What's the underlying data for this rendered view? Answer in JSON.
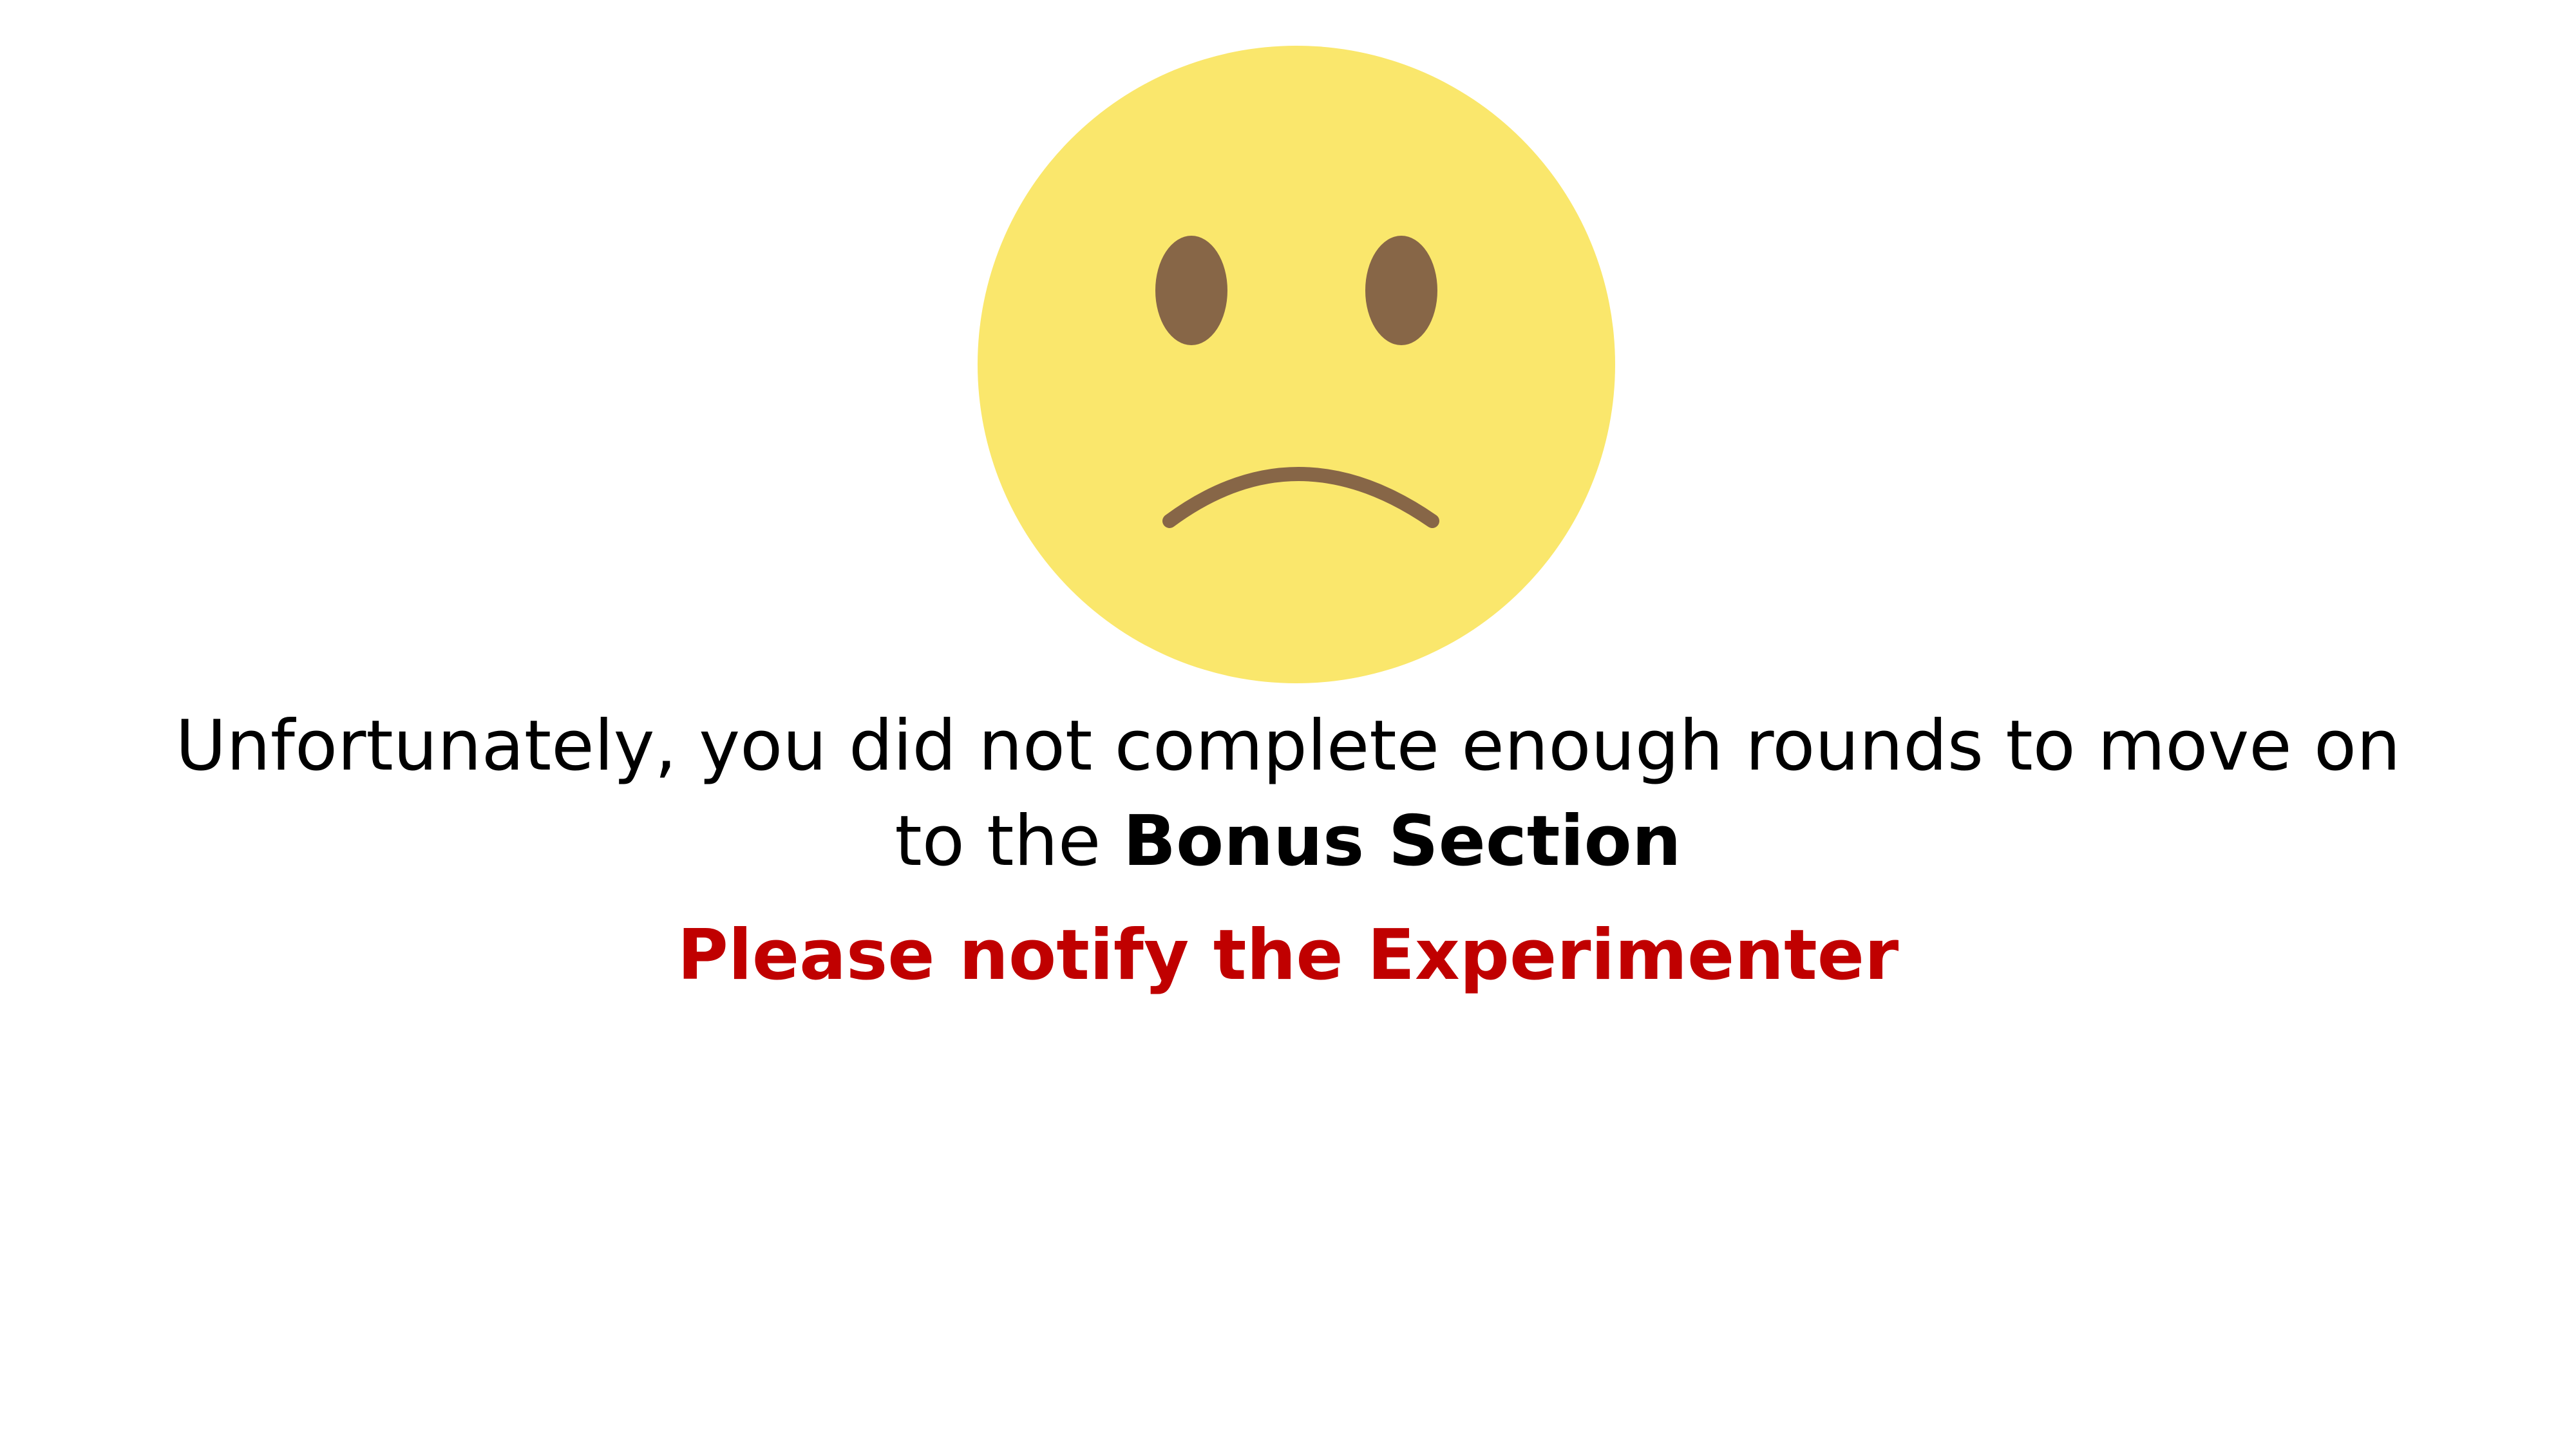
{
  "message": {
    "text_before": "Unfortunately, you did not complete enough rounds to move on to the ",
    "bold_text": "Bonus Section"
  },
  "notice": {
    "text": "Please notify the Experimenter",
    "color": "#c00000"
  },
  "face": {
    "icon": "sad-face-icon",
    "face_color": "#fae76c",
    "feature_color": "#876647"
  }
}
